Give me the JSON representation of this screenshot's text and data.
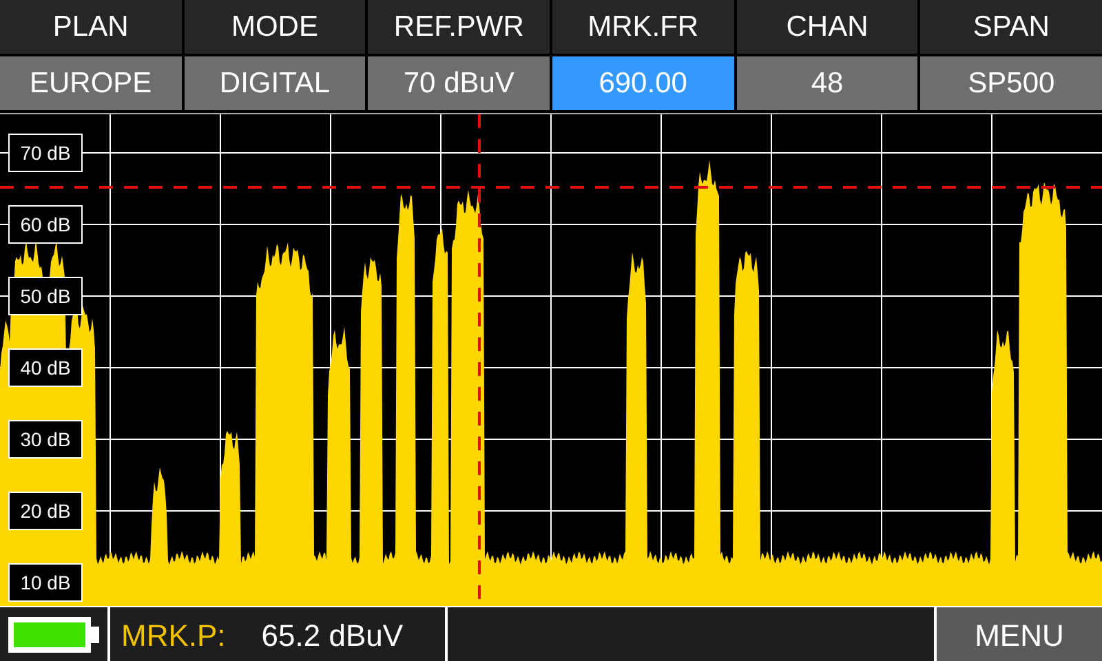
{
  "header": [
    {
      "label": "PLAN",
      "value": "EUROPE",
      "selected": false
    },
    {
      "label": "MODE",
      "value": "DIGITAL",
      "selected": false
    },
    {
      "label": "REF.PWR",
      "value": "70 dBuV",
      "selected": false
    },
    {
      "label": "MRK.FR",
      "value": "690.00",
      "selected": true
    },
    {
      "label": "CHAN",
      "value": "48",
      "selected": false
    },
    {
      "label": "SPAN",
      "value": "SP500",
      "selected": false
    }
  ],
  "spectrum": {
    "y_labels": [
      "70 dB",
      "60 dB",
      "50 dB",
      "40 dB",
      "30 dB",
      "20 dB",
      "10 dB"
    ]
  },
  "status_bar": {
    "marker_label": "MRK.P:",
    "marker_value": "65.2 dBuV",
    "menu": "MENU"
  }
}
